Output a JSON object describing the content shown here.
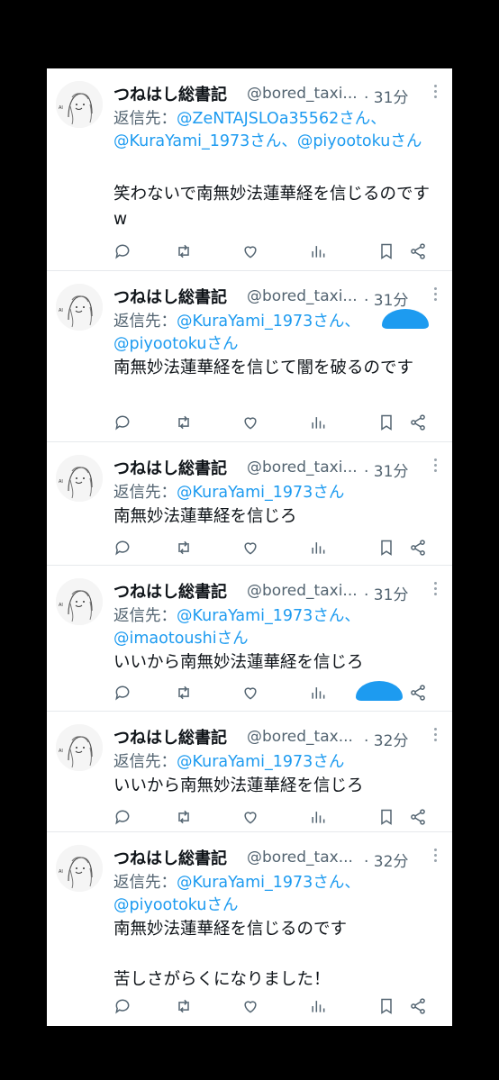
{
  "tweets": [
    {
      "name": "つねはし総書記",
      "handle": "@bored_taxi...",
      "time": "· 31分",
      "reply_prefix": "返信先：",
      "mentions": [
        "@ZeNTAJSLOa35562さん、",
        "@KuraYami_1973さん、",
        "@piyootokuさん"
      ],
      "text": "笑わないで南無妙法蓮華経を信じるのですw"
    },
    {
      "name": "つねはし総書記",
      "handle": "@bored_taxi...",
      "time": "· 31分",
      "reply_prefix": "返信先：",
      "mentions": [
        "@KuraYami_1973さん、",
        "@piyootokuさん"
      ],
      "text": "南無妙法蓮華経を信じて闇を破るのです"
    },
    {
      "name": "つねはし総書記",
      "handle": "@bored_taxi...",
      "time": "· 31分",
      "reply_prefix": "返信先：",
      "mentions": [
        "@KuraYami_1973さん"
      ],
      "text": "南無妙法蓮華経を信じろ"
    },
    {
      "name": "つねはし総書記",
      "handle": "@bored_taxi...",
      "time": "· 31分",
      "reply_prefix": "返信先：",
      "mentions": [
        "@KuraYami_1973さん、",
        "@imaotoushiさん"
      ],
      "text": "いいから南無妙法蓮華経を信じろ"
    },
    {
      "name": "つねはし総書記",
      "handle": "@bored_tax...",
      "time": "· 32分",
      "reply_prefix": "返信先：",
      "mentions": [
        "@KuraYami_1973さん"
      ],
      "text": "いいから南無妙法蓮華経を信じろ"
    },
    {
      "name": "つねはし総書記",
      "handle": "@bored_tax...",
      "time": "· 32分",
      "reply_prefix": "返信先：",
      "mentions": [
        "@KuraYami_1973さん、",
        "@piyootokuさん"
      ],
      "text": "南無妙法蓮華経を信じるのです\n\n苦しさがらくになりました！"
    }
  ],
  "colors": {
    "mention": "#1d9bf0",
    "secondary": "#536471",
    "text": "#0f1419",
    "background": "#000000",
    "card": "#ffffff"
  },
  "action_icons": [
    "reply-icon",
    "retweet-icon",
    "like-icon",
    "views-icon",
    "bookmark-icon",
    "share-icon"
  ]
}
